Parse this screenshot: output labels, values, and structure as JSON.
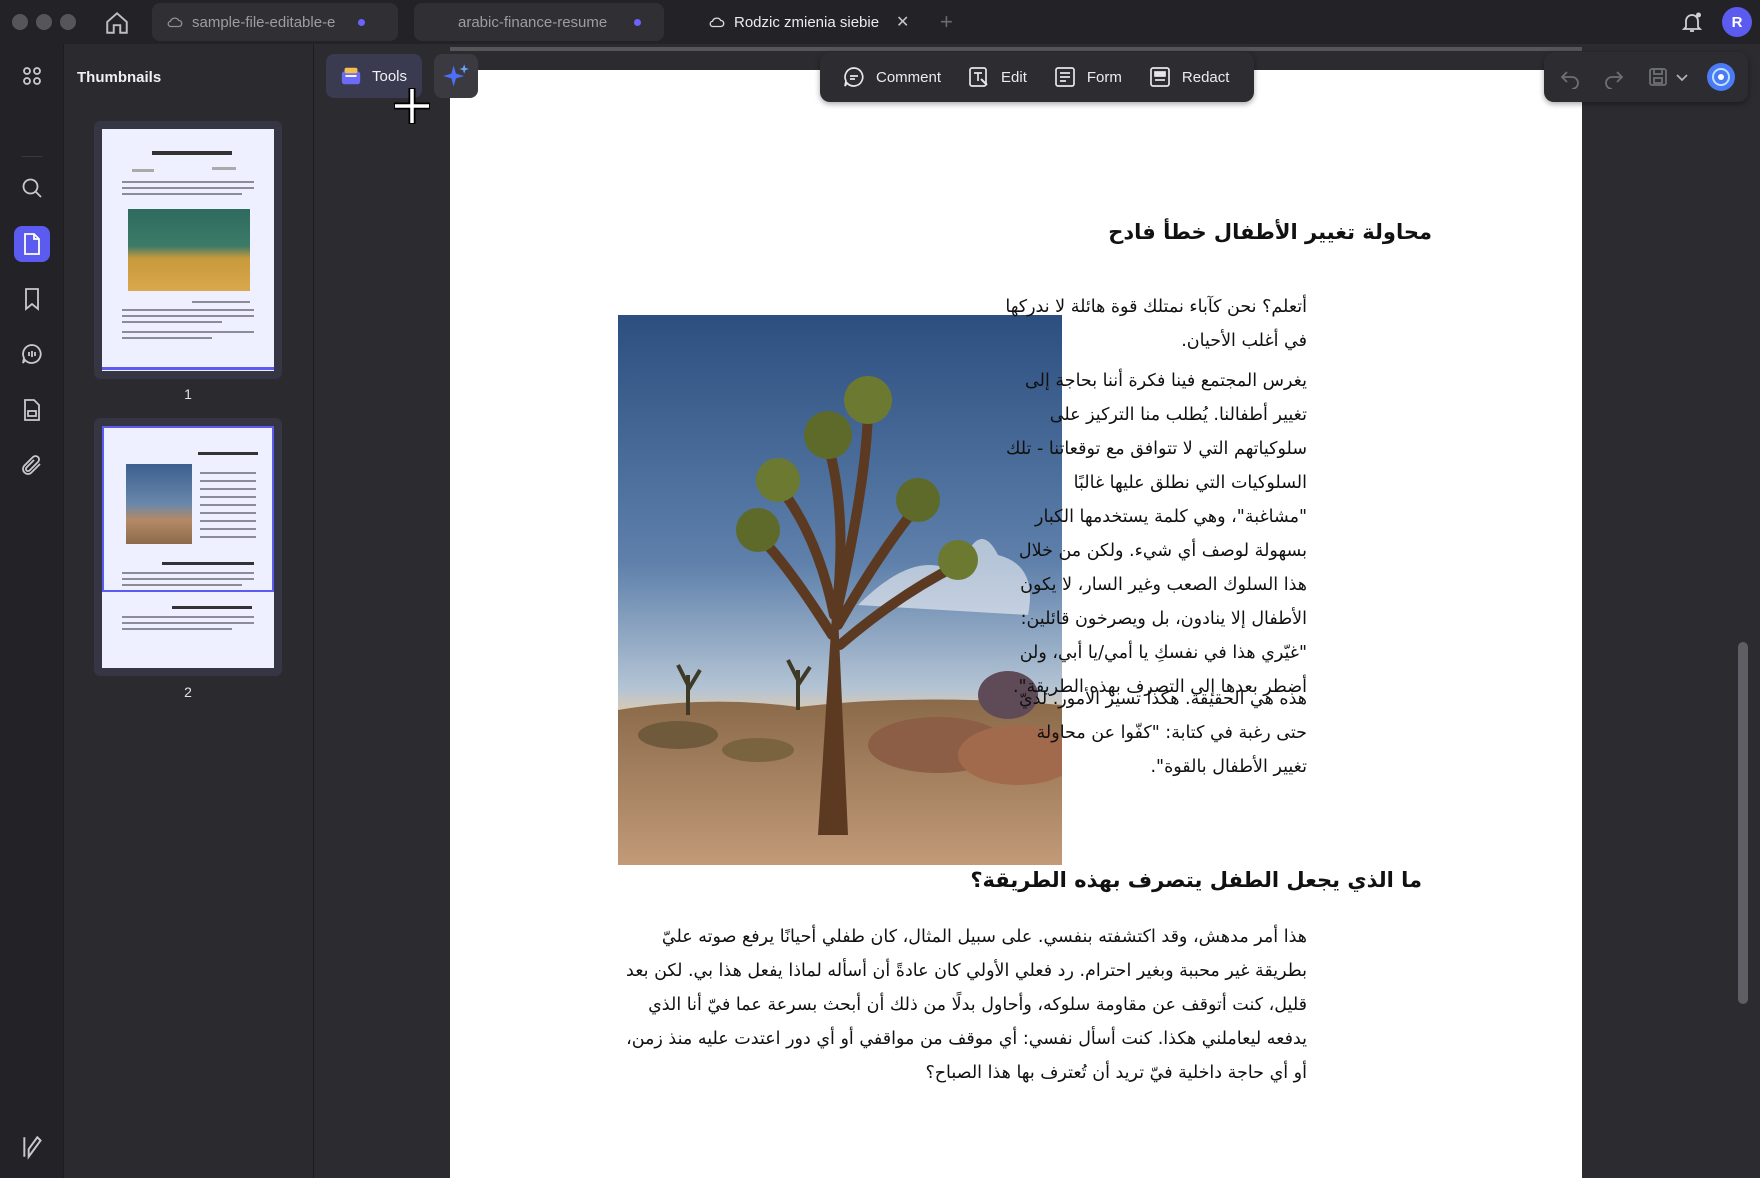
{
  "tabs": [
    {
      "label": "sample-file-editable-e",
      "modified": true
    },
    {
      "label": "arabic-finance-resume",
      "modified": true
    },
    {
      "label": "Rodzic zmienia siebie",
      "active": true
    }
  ],
  "account": {
    "initial": "R"
  },
  "thumbnails": {
    "title": "Thumbnails",
    "pages": [
      "1",
      "2"
    ]
  },
  "toolbar": {
    "tools_label": "Tools",
    "comment_label": "Comment",
    "edit_label": "Edit",
    "form_label": "Form",
    "redact_label": "Redact"
  },
  "document": {
    "heading1": "محاولة تغيير الأطفال خطأ فادح",
    "p1": "أتعلم؟ نحن كآباء نمتلك قوة هائلة لا ندركها في أغلب الأحيان.",
    "p2": "يغرس المجتمع فينا فكرة أننا بحاجة إلى تغيير أطفالنا. يُطلب منا التركيز على سلوكياتهم التي لا تتوافق مع توقعاتنا - تلك السلوكيات التي نطلق عليها غالبًا \"مشاغبة\"، وهي كلمة يستخدمها الكبار بسهولة لوصف أي شيء. ولكن من خلال هذا السلوك الصعب وغير السار، لا يكون الأطفال إلا ينادون، بل ويصرخون قائلين: \"غيّري هذا في نفسكِ يا أمي/يا أبي، ولن أضطر بعدها إلى التصرف بهذه الطريقة\".",
    "p3": "هذه هي الحقيقة. هكذا تسير الأمور. لديّ حتى رغبة في كتابة: \"كفّوا عن محاولة تغيير الأطفال بالقوة\".",
    "heading2": "ما الذي يجعل الطفل يتصرف بهذه الطريقة؟",
    "p4": "هذا أمر مدهش، وقد اكتشفته بنفسي. على سبيل المثال، كان طفلي أحيانًا يرفع صوته عليّ بطريقة غير محببة وبغير احترام. رد فعلي الأولي كان عادةً أن أسأله لماذا يفعل هذا بي. لكن بعد قليل، كنت أتوقف عن مقاومة سلوكه، وأحاول بدلًا من ذلك أن أبحث بسرعة عما فيّ أنا الذي يدفعه ليعاملني هكذا. كنت أسأل نفسي: أي موقف من مواقفي أو أي دور اعتدت عليه منذ زمن، أو أي حاجة داخلية فيّ تريد أن تُعترف بها هذا الصباح؟"
  },
  "colors": {
    "accent": "#5b5bf0",
    "chrome": "#232327",
    "workspace": "#2b2b30"
  }
}
